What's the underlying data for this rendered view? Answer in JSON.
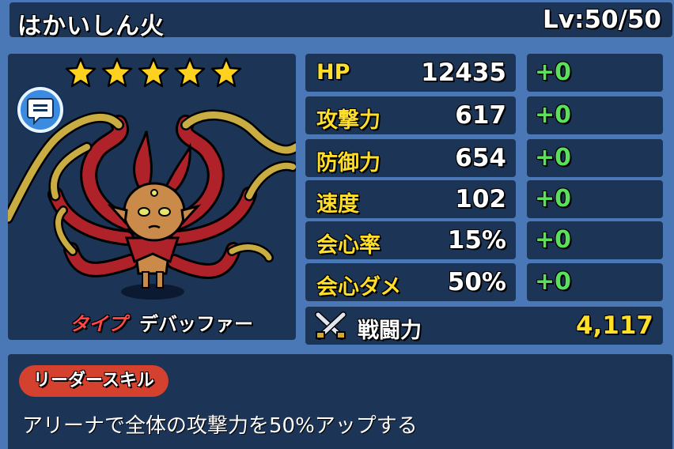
{
  "header": {
    "name": "はかいしん火",
    "level": "Lv:50/50"
  },
  "character": {
    "stars": 5,
    "type_label": "タイプ",
    "type_value": "デバッファー"
  },
  "stats": [
    {
      "label": "HP",
      "value": "12435",
      "bonus": "+0"
    },
    {
      "label": "攻撃力",
      "value": "617",
      "bonus": "+0"
    },
    {
      "label": "防御力",
      "value": "654",
      "bonus": "+0"
    },
    {
      "label": "速度",
      "value": "102",
      "bonus": "+0"
    },
    {
      "label": "会心率",
      "value": "15%",
      "bonus": "+0"
    },
    {
      "label": "会心ダメ",
      "value": "50%",
      "bonus": "+0"
    }
  ],
  "power": {
    "label": "戦闘力",
    "value": "4,117"
  },
  "leader_skill": {
    "badge": "リーダースキル",
    "description": "アリーナで全体の攻撃力を50%アップする"
  },
  "colors": {
    "background": "#4a78b6",
    "panel": "#1c3456",
    "stat_label": "#ffdf2a",
    "bonus": "#5be05b",
    "type_label": "#ff4949",
    "skill_badge": "#d4412e"
  }
}
